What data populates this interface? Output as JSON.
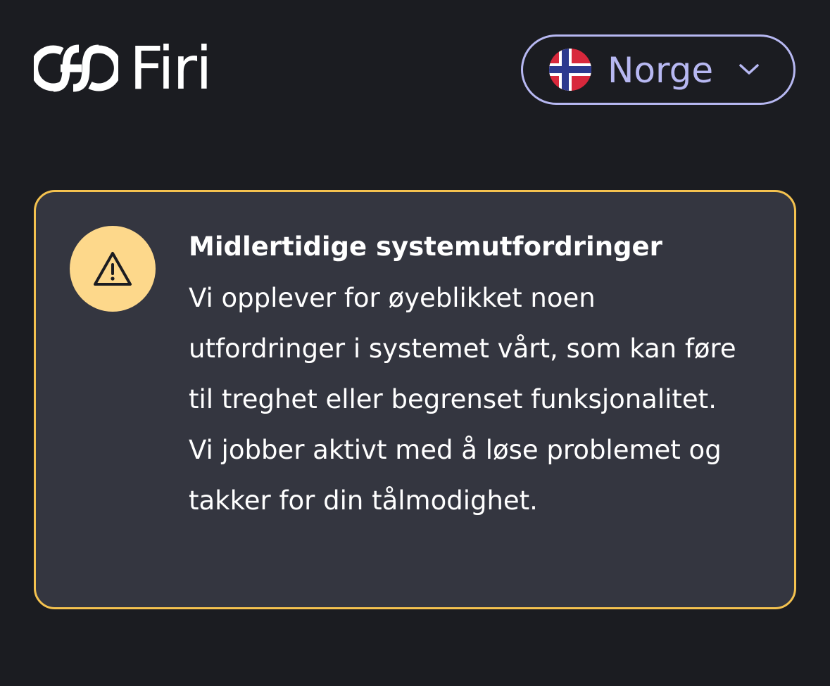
{
  "header": {
    "brand_name": "Firi",
    "country_selector": {
      "label": "Norge",
      "flag_icon": "norway-flag-icon",
      "chevron_icon": "chevron-down-icon",
      "border_color": "#b7b8f2",
      "text_color": "#b7b8f2"
    }
  },
  "alert": {
    "icon": "warning-icon",
    "title": "Midlertidige systemutfordringer",
    "body": "Vi opplever for øyeblikket noen utfordringer i systemet vårt, som kan føre til treghet eller begrenset funksjonalitet. Vi jobber aktivt med å løse problemet og takker for din tålmodighet.",
    "border_color": "#f4c24f",
    "icon_bg_color": "#fdd88b",
    "background_color": "#343640"
  },
  "colors": {
    "page_background": "#1b1c21",
    "text": "#ffffff"
  }
}
